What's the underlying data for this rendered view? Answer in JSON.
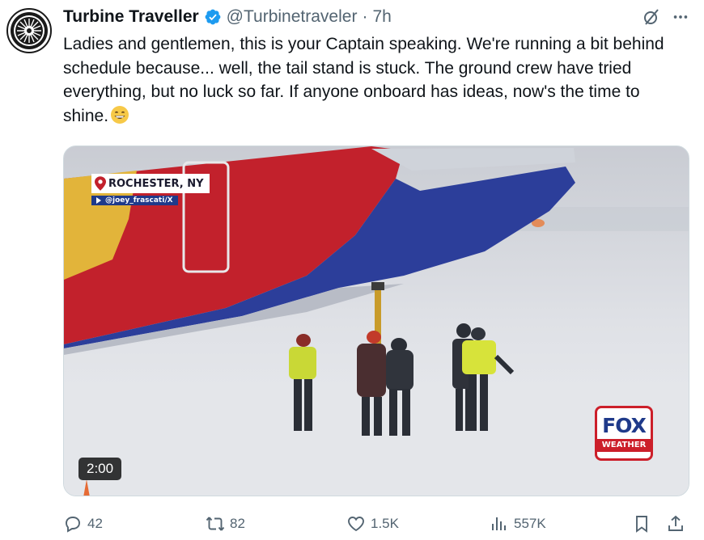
{
  "tweet": {
    "display_name": "Turbine Traveller",
    "handle": "@Turbinetraveler",
    "separator": "·",
    "time": "7h",
    "text": "Ladies and gentlemen, this is your Captain speaking. We're running a bit behind schedule because... well, the tail stand is stuck. The ground crew have tried everything, but no luck so far. If anyone onboard has ideas, now's the time to shine."
  },
  "media": {
    "location_label": "ROCHESTER, NY",
    "credit_label": "@joey_frascati/X",
    "logo_word": "FOX",
    "logo_sub": "WEATHER",
    "duration": "2:00"
  },
  "actions": {
    "replies": "42",
    "reposts": "82",
    "likes": "1.5K",
    "views": "557K"
  },
  "colors": {
    "text": "#0f1419",
    "muted": "#536471",
    "verified": "#1d9bf0",
    "plane_red": "#c2212c",
    "plane_blue": "#2c3e9a",
    "plane_yellow": "#e2b43a"
  },
  "icons": [
    "turbine-avatar",
    "verified-badge-icon",
    "grok-icon",
    "more-icon",
    "reply-icon",
    "repost-icon",
    "like-icon",
    "views-icon",
    "bookmark-icon",
    "share-icon",
    "location-pin-icon",
    "play-icon",
    "grin-emoji"
  ]
}
